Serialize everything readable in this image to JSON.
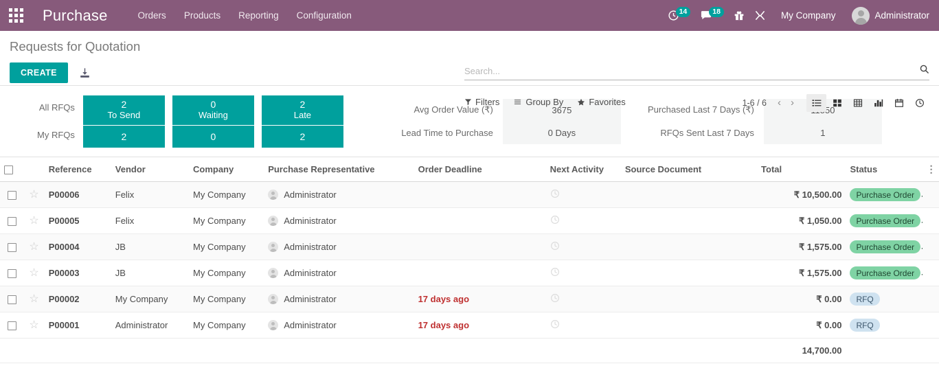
{
  "navbar": {
    "apps_icon": "apps-grid-icon",
    "brand": "Purchase",
    "menu": [
      {
        "label": "Orders"
      },
      {
        "label": "Products"
      },
      {
        "label": "Reporting"
      },
      {
        "label": "Configuration"
      }
    ],
    "activity_icon": "clock-activity-icon",
    "activity_count": "14",
    "messages_icon": "chat-bubble-icon",
    "messages_count": "18",
    "gift_icon": "gift-icon",
    "tools_icon": "wrench-tools-icon",
    "company": "My Company",
    "user": "Administrator",
    "avatar_icon": "user-avatar",
    "accent_purple": "#875A7B",
    "accent_teal": "#00A09D"
  },
  "control_panel": {
    "title": "Requests for Quotation",
    "create_label": "CREATE",
    "import_icon": "import-download-icon",
    "search": {
      "placeholder": "Search...",
      "value": "",
      "icon": "search-icon"
    },
    "filters": [
      {
        "label": "Filters",
        "icon": "filter-funnel-icon"
      },
      {
        "label": "Group By",
        "icon": "group-by-bars-icon"
      },
      {
        "label": "Favorites",
        "icon": "star-icon"
      }
    ],
    "pager": {
      "range": "1-6 / 6",
      "prev_icon": "chevron-left-icon",
      "next_icon": "chevron-right-icon"
    },
    "views": [
      {
        "name": "list",
        "icon": "list-view-icon",
        "active": true
      },
      {
        "name": "kanban",
        "icon": "kanban-view-icon",
        "active": false
      },
      {
        "name": "pivot",
        "icon": "pivot-view-icon",
        "active": false
      },
      {
        "name": "graph",
        "icon": "graph-view-icon",
        "active": false
      },
      {
        "name": "calendar",
        "icon": "calendar-view-icon",
        "active": false
      },
      {
        "name": "activity",
        "icon": "activity-clock-view-icon",
        "active": false
      }
    ]
  },
  "dashboard": {
    "row_labels": {
      "all": "All RFQs",
      "my": "My RFQs"
    },
    "tiles": [
      {
        "label": "To Send",
        "all_count": "2",
        "my_count": "2"
      },
      {
        "label": "Waiting",
        "all_count": "0",
        "my_count": "0"
      },
      {
        "label": "Late",
        "all_count": "2",
        "my_count": "2"
      }
    ],
    "stats": [
      {
        "label": "Avg Order Value (₹)",
        "value": "3675"
      },
      {
        "label": "Lead Time to Purchase",
        "value": "0  Days"
      },
      {
        "label": "Purchased Last 7 Days (₹)",
        "value": "11550"
      },
      {
        "label": "RFQs Sent Last 7 Days",
        "value": "1"
      }
    ]
  },
  "table": {
    "columns": [
      "",
      "",
      "Reference",
      "Vendor",
      "Company",
      "Purchase Representative",
      "Order Deadline",
      "Next Activity",
      "Source Document",
      "Total",
      "Status",
      ""
    ],
    "options_icon": "column-options-icon",
    "rows": [
      {
        "reference": "P00006",
        "vendor": "Felix",
        "company": "My Company",
        "representative": "Administrator",
        "order_deadline": "",
        "deadline_late": false,
        "next_activity": "",
        "source_document": "",
        "total": "₹ 10,500.00",
        "status": "Purchase Order",
        "status_type": "po"
      },
      {
        "reference": "P00005",
        "vendor": "Felix",
        "company": "My Company",
        "representative": "Administrator",
        "order_deadline": "",
        "deadline_late": false,
        "next_activity": "",
        "source_document": "",
        "total": "₹ 1,050.00",
        "status": "Purchase Order",
        "status_type": "po"
      },
      {
        "reference": "P00004",
        "vendor": "JB",
        "company": "My Company",
        "representative": "Administrator",
        "order_deadline": "",
        "deadline_late": false,
        "next_activity": "",
        "source_document": "",
        "total": "₹ 1,575.00",
        "status": "Purchase Order",
        "status_type": "po"
      },
      {
        "reference": "P00003",
        "vendor": "JB",
        "company": "My Company",
        "representative": "Administrator",
        "order_deadline": "",
        "deadline_late": false,
        "next_activity": "",
        "source_document": "",
        "total": "₹ 1,575.00",
        "status": "Purchase Order",
        "status_type": "po"
      },
      {
        "reference": "P00002",
        "vendor": "My Company",
        "company": "My Company",
        "representative": "Administrator",
        "order_deadline": "17 days ago",
        "deadline_late": true,
        "next_activity": "",
        "source_document": "",
        "total": "₹ 0.00",
        "status": "RFQ",
        "status_type": "rfq"
      },
      {
        "reference": "P00001",
        "vendor": "Administrator",
        "company": "My Company",
        "representative": "Administrator",
        "order_deadline": "17 days ago",
        "deadline_late": true,
        "next_activity": "",
        "source_document": "",
        "total": "₹ 0.00",
        "status": "RFQ",
        "status_type": "rfq"
      }
    ],
    "footer_total": "14,700.00"
  }
}
